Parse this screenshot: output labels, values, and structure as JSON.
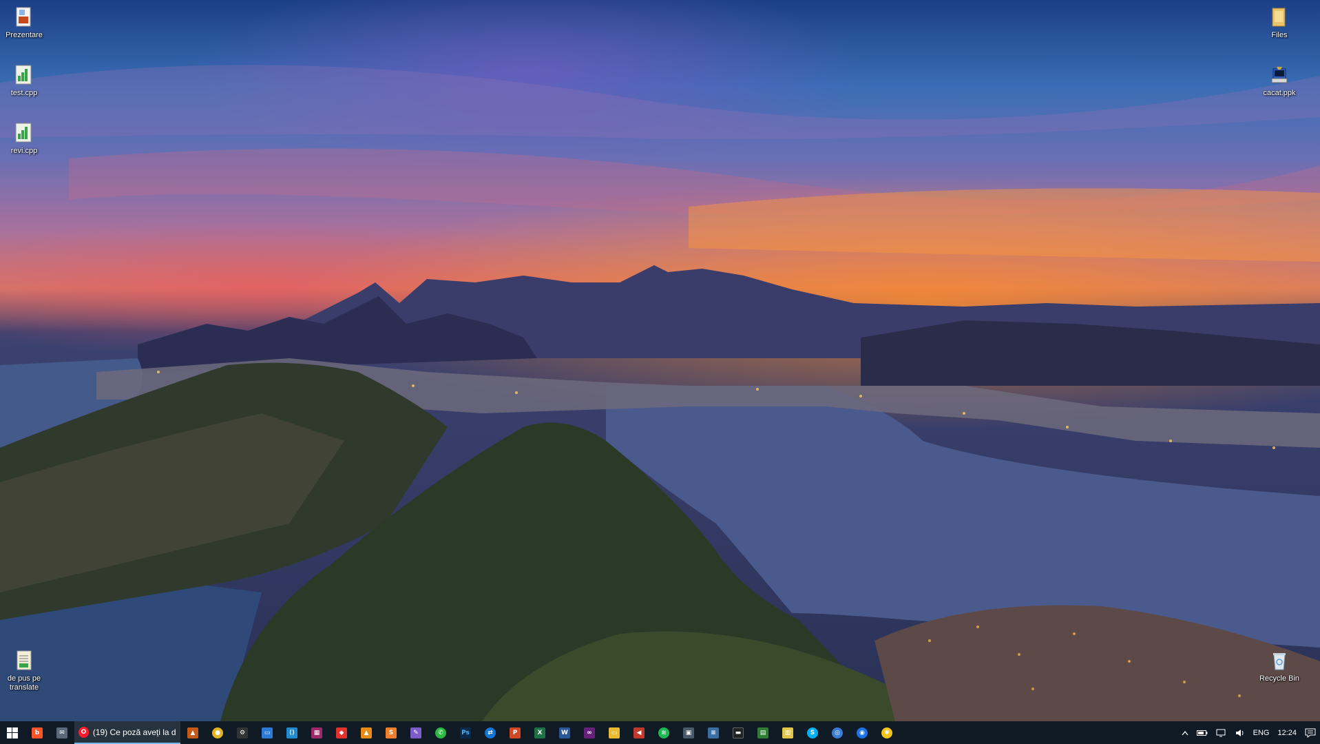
{
  "desktop": {
    "icons_left": [
      {
        "label": "Prezentare",
        "icon": "pptx-file-icon"
      },
      {
        "label": "test.cpp",
        "icon": "cpp-file-icon"
      },
      {
        "label": "revi.cpp",
        "icon": "cpp-file-icon"
      },
      {
        "label": "de pus pe translate",
        "icon": "text-file-icon"
      }
    ],
    "icons_right": [
      {
        "label": "Files",
        "icon": "folder-file-icon"
      },
      {
        "label": "cacat.ppk",
        "icon": "putty-key-icon"
      },
      {
        "label": "Recycle Bin",
        "icon": "recycle-bin-icon"
      }
    ]
  },
  "taskbar": {
    "active_window_title": "(19) Ce poză aveți la d...",
    "pinned": [
      "brave-icon",
      "email-icon",
      "opera-browser-icon",
      "matlab-icon",
      "chrome-icon",
      "settings-icon",
      "remote-desktop-icon",
      "vscode-icon",
      "winrar-icon",
      "anydesk-icon",
      "vlc-icon",
      "sublime-icon",
      "pen-icon",
      "whatsapp-icon",
      "photoshop-icon",
      "teamviewer-icon",
      "powerpoint-icon",
      "excel-icon",
      "word-icon",
      "visual-studio-icon",
      "file-explorer-icon",
      "speaker-app-icon",
      "spotify-icon",
      "network-app-icon",
      "notepad-icon",
      "ssd-icon",
      "terminal-icon",
      "notes-icon",
      "skype-icon",
      "browser-icon",
      "webcam-icon",
      "paint-icon"
    ],
    "tray": {
      "language": "ENG",
      "time": "12:24"
    }
  }
}
